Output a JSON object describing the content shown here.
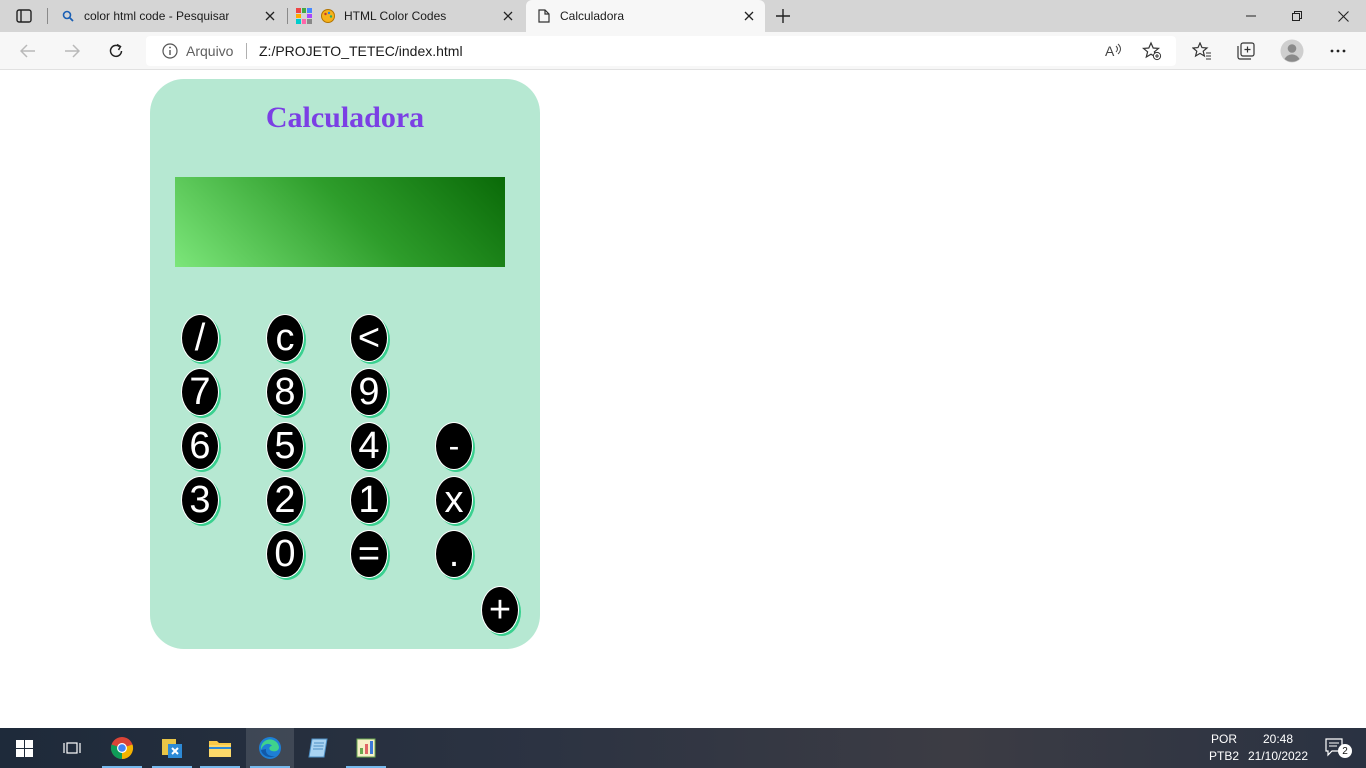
{
  "browser": {
    "tabs": [
      {
        "title": "color html code - Pesquisar",
        "icon": "search-icon"
      },
      {
        "title": "HTML Color Codes",
        "icon": "palette-icon"
      },
      {
        "title": "Calculadora",
        "icon": "page-icon"
      }
    ],
    "address": {
      "security_label": "Arquivo",
      "url": "Z:/PROJETO_TETEC/index.html"
    }
  },
  "page": {
    "title": "Calculadora",
    "display_value": "",
    "keys": {
      "divide": "/",
      "clear": "c",
      "backspace": "<",
      "seven": "7",
      "eight": "8",
      "nine": "9",
      "six": "6",
      "five": "5",
      "four": "4",
      "minus": "-",
      "three": "3",
      "two": "2",
      "one": "1",
      "multiply": "x",
      "zero": "0",
      "equals": "=",
      "dot": ".",
      "plus": "+"
    },
    "colors": {
      "panel": "#b6e8d2",
      "title": "#7b3fe4",
      "display_dark": "#0a6a08",
      "display_light": "#7ce67a",
      "key": "#000000",
      "key_shadow": "#39d08f"
    }
  },
  "taskbar": {
    "apps": [
      "windows-start-icon",
      "task-view-icon",
      "chrome-icon",
      "app-icon",
      "file-explorer-icon",
      "edge-icon",
      "notepad-icon",
      "spreadsheet-icon"
    ],
    "language_line1": "POR",
    "language_line2": "PTB2",
    "time": "20:48",
    "date": "21/10/2022",
    "notifications_count": "2"
  }
}
